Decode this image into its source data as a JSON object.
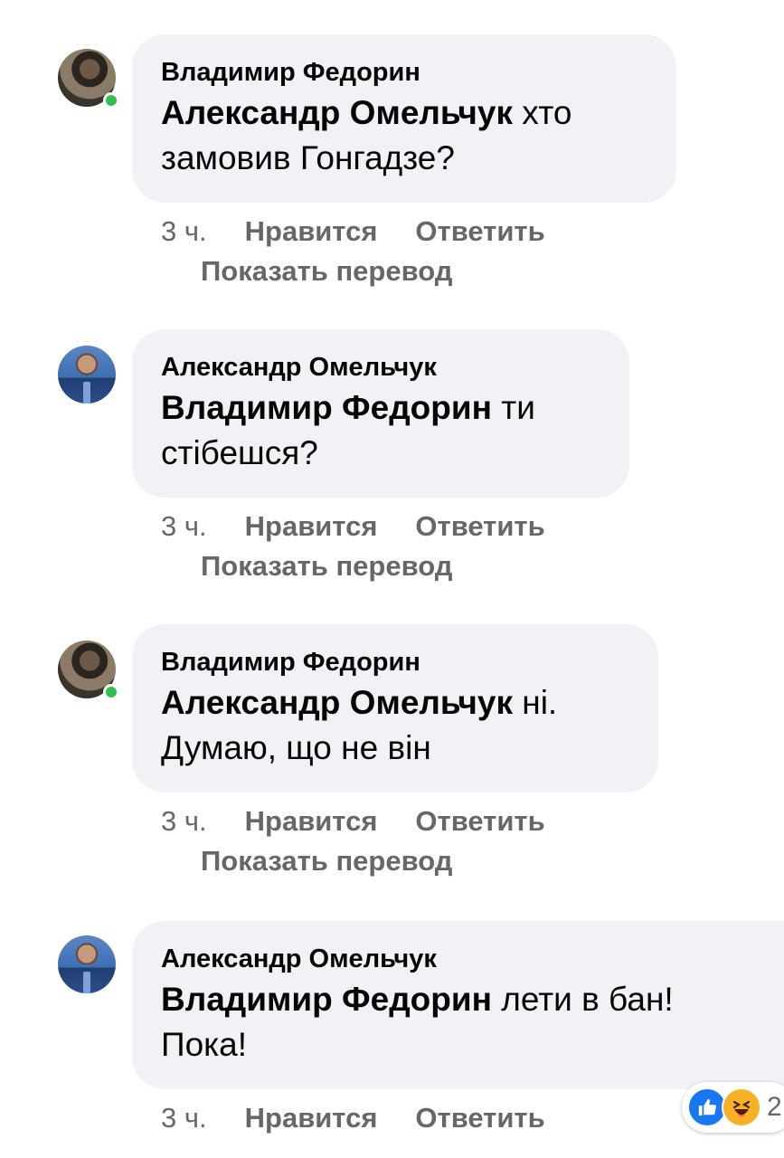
{
  "comments": [
    {
      "author": "Владимир Федорин",
      "mention": "Александр Омельчук",
      "text_line1": " хто",
      "text_line2": "замовив Гонгадзе?",
      "time": "3 ч.",
      "like_label": "Нравится",
      "reply_label": "Ответить",
      "translate_label": "Показать перевод",
      "online": true
    },
    {
      "author": "Александр Омельчук",
      "mention": "Владимир Федорин",
      "text_line1": " ти",
      "text_line2": "стібешся?",
      "time": "3 ч.",
      "like_label": "Нравится",
      "reply_label": "Ответить",
      "translate_label": "Показать перевод",
      "online": false
    },
    {
      "author": "Владимир Федорин",
      "mention": "Александр Омельчук",
      "text_line1": " ні.",
      "text_line2": "Думаю, що не він",
      "time": "3 ч.",
      "like_label": "Нравится",
      "reply_label": "Ответить",
      "translate_label": "Показать перевод",
      "online": true
    },
    {
      "author": "Александр Омельчук",
      "mention": "Владимир Федорин",
      "text_line1": " лети в бан!",
      "text_line2": "Пока!",
      "time": "3 ч.",
      "like_label": "Нравится",
      "reply_label": "Ответить",
      "online": false,
      "reactions": {
        "icons": [
          "like-icon",
          "haha-icon"
        ],
        "count": "2"
      }
    }
  ],
  "colors": {
    "bubble": "#f0f2f5",
    "meta": "#65676b",
    "online": "#31c04d",
    "like": "#1877f2",
    "haha": "#f7b125"
  }
}
